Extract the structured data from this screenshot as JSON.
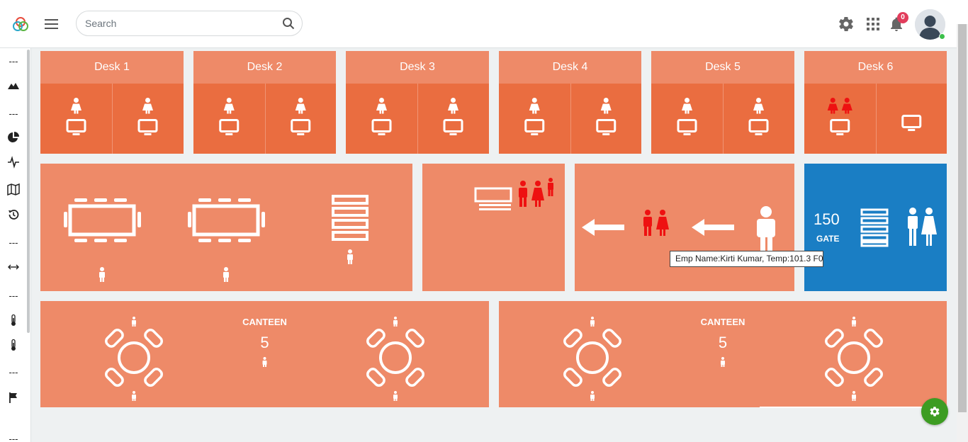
{
  "header": {
    "search_placeholder": "Search",
    "notification_count": "0",
    "icons": [
      "app-logo-icon",
      "menu-icon",
      "search-icon",
      "gear-icon",
      "apps-grid-icon",
      "bell-icon",
      "avatar"
    ]
  },
  "sidebar": {
    "items": [
      {
        "type": "separator",
        "label": "---"
      },
      {
        "type": "icon",
        "icon": "mountains-icon"
      },
      {
        "type": "separator",
        "label": "---"
      },
      {
        "type": "icon",
        "icon": "pie-chart-icon"
      },
      {
        "type": "icon",
        "icon": "pulse-icon"
      },
      {
        "type": "icon",
        "icon": "map-icon"
      },
      {
        "type": "icon",
        "icon": "history-icon"
      },
      {
        "type": "separator",
        "label": "---"
      },
      {
        "type": "icon",
        "icon": "arrows-horizontal-icon"
      },
      {
        "type": "separator",
        "label": "---"
      },
      {
        "type": "icon",
        "icon": "thermometer-icon"
      },
      {
        "type": "icon",
        "icon": "thermometer-icon"
      },
      {
        "type": "separator",
        "label": "---"
      },
      {
        "type": "icon",
        "icon": "flag-icon"
      },
      {
        "type": "separator",
        "label": "---"
      }
    ]
  },
  "desks": [
    {
      "label": "Desk 1",
      "seats": [
        {
          "occupants": 1,
          "alert": false
        },
        {
          "occupants": 1,
          "alert": false
        }
      ]
    },
    {
      "label": "Desk 2",
      "seats": [
        {
          "occupants": 1,
          "alert": false
        },
        {
          "occupants": 1,
          "alert": false
        }
      ]
    },
    {
      "label": "Desk 3",
      "seats": [
        {
          "occupants": 1,
          "alert": false
        },
        {
          "occupants": 1,
          "alert": false
        }
      ]
    },
    {
      "label": "Desk 4",
      "seats": [
        {
          "occupants": 1,
          "alert": false
        },
        {
          "occupants": 1,
          "alert": false
        }
      ]
    },
    {
      "label": "Desk 5",
      "seats": [
        {
          "occupants": 1,
          "alert": false
        },
        {
          "occupants": 1,
          "alert": false
        }
      ]
    },
    {
      "label": "Desk 6",
      "seats": [
        {
          "occupants": 2,
          "alert": true
        },
        {
          "occupants": 0,
          "alert": false
        }
      ]
    }
  ],
  "gate": {
    "count": "150",
    "label": "GATE"
  },
  "tooltip": {
    "text": "Emp Name:Kirti Kumar, Temp:101.3 F0"
  },
  "canteens": [
    {
      "label": "CANTEEN",
      "count": "5"
    },
    {
      "label": "CANTEEN",
      "count": "5"
    }
  ],
  "colors": {
    "block": "#ee8a68",
    "desk_body": "#ea6d40",
    "gate": "#1a7ec4",
    "alert": "#ee1111",
    "fab": "#3c9c22"
  }
}
